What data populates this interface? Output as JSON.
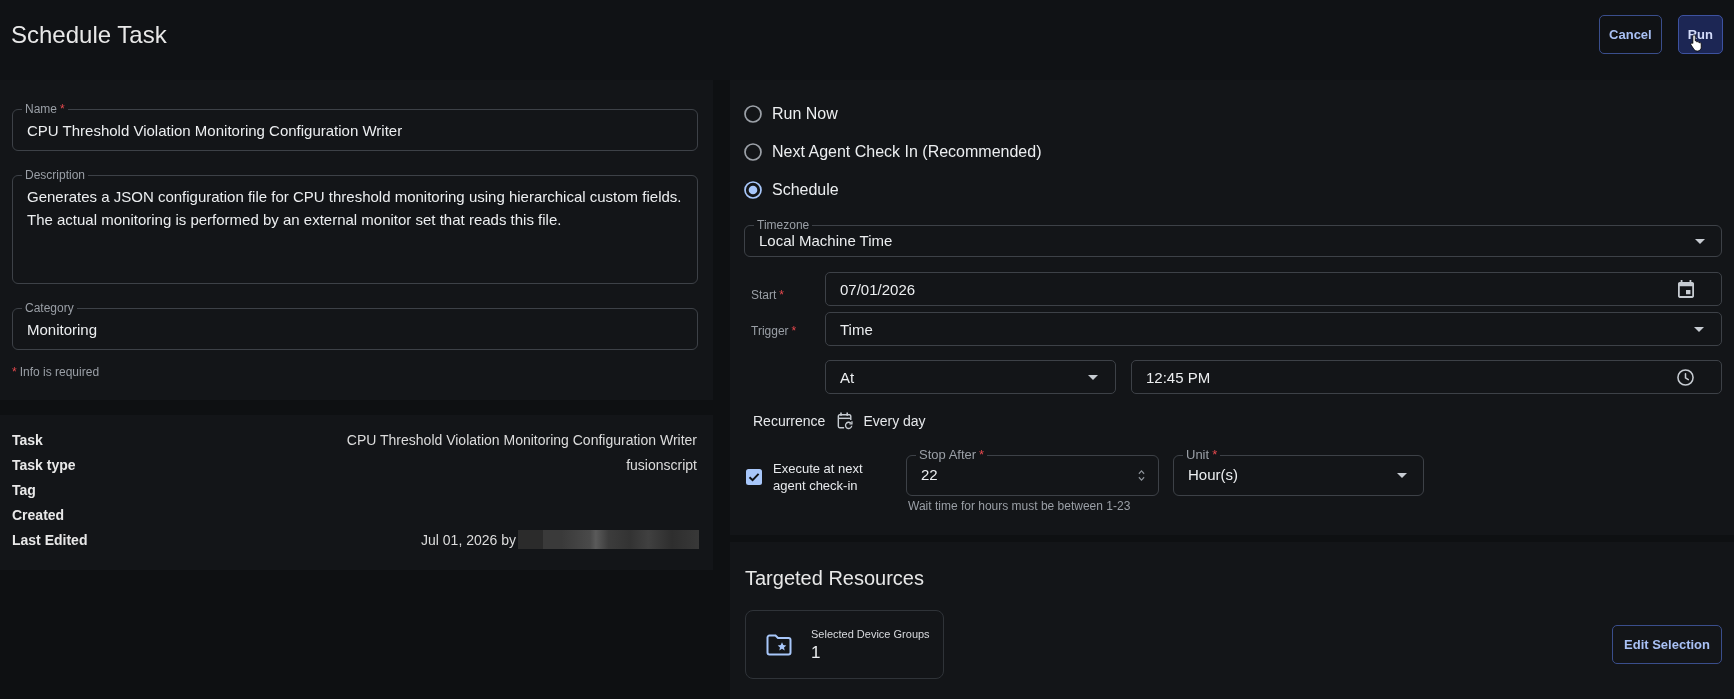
{
  "header": {
    "title": "Schedule Task",
    "buttons": [
      {
        "label": "Cancel",
        "kind": "outlined"
      },
      {
        "label": "Run",
        "kind": "filled"
      }
    ]
  },
  "details": {
    "fields": [
      {
        "kind": "text",
        "label": "Name",
        "required_mark": "*",
        "value": "CPU Threshold Violation Monitoring Configuration Writer"
      },
      {
        "kind": "textarea",
        "label": "Description",
        "value": "Generates a JSON configuration file for CPU threshold monitoring using hierarchical custom fields.\nThe actual monitoring is performed by an external monitor set that reads this file."
      },
      {
        "kind": "text",
        "label": "Category",
        "value": "Monitoring"
      }
    ],
    "note": {
      "mark": "*",
      "text": "Info is required"
    }
  },
  "summary": {
    "rows": [
      {
        "label": "Task",
        "value": "CPU Threshold Violation Monitoring Configuration Writer"
      },
      {
        "label": "Task type",
        "value": "fusionscript"
      },
      {
        "label": "Tag"
      },
      {
        "label": "Created"
      },
      {
        "label": "Last Edited",
        "value": "Jul 01, 2026 by",
        "redacted": true
      }
    ]
  },
  "run_options": [
    {
      "label": "Run Now",
      "selected": false
    },
    {
      "label": "Next Agent Check In (Recommended)",
      "selected": false
    },
    {
      "label": "Schedule",
      "selected": true
    }
  ],
  "schedule": {
    "timezone": {
      "label": "Timezone",
      "value": "Local Machine Time"
    },
    "start": {
      "label": "Start",
      "required_mark": "*",
      "value": "07/01/2026"
    },
    "trigger": {
      "label": "Trigger",
      "required_mark": "*",
      "value": "Time"
    },
    "trigger_mode": {
      "value": "At"
    },
    "trigger_time": {
      "value": "12:45 PM"
    },
    "recurrence": {
      "label": "Recurrence",
      "value": "Every day"
    },
    "execute_next_checkin": {
      "label": "Execute at next agent check-in",
      "checked": true
    },
    "stop_after": {
      "label": "Stop After",
      "required_mark": "*",
      "value": "22",
      "helper": "Wait time for hours must be between 1-23"
    },
    "unit": {
      "label": "Unit",
      "required_mark": "*",
      "value": "Hour(s)"
    }
  },
  "targeted_resources": {
    "title": "Targeted Resources",
    "cards": [
      {
        "label": "Selected Device Groups",
        "count": "1"
      }
    ],
    "button": "Edit Selection"
  }
}
